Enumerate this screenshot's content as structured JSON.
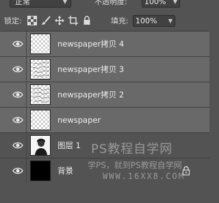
{
  "header": {
    "blend_mode": "正常",
    "opacity_label": "不透明度:",
    "opacity_value": "100%"
  },
  "lock_row": {
    "lock_label": "锁定:",
    "fill_label": "填充:",
    "fill_value": "100%",
    "lock_icons": [
      "lock-transparent-pixels-icon",
      "lock-image-pixels-icon",
      "lock-position-icon",
      "lock-artboard-icon",
      "lock-all-icon"
    ]
  },
  "layers": [
    {
      "name": "newspaper拷贝 4",
      "visible": true,
      "thumb": "transparent",
      "selected": true
    },
    {
      "name": "newspaper拷贝 3",
      "visible": true,
      "thumb": "texture",
      "selected": true
    },
    {
      "name": "newspaper拷贝 2",
      "visible": true,
      "thumb": "texture",
      "selected": true
    },
    {
      "name": "newspaper",
      "visible": true,
      "thumb": "transparent",
      "selected": true
    },
    {
      "name": "图层 1",
      "visible": true,
      "thumb": "photo",
      "selected": false
    },
    {
      "name": "背景",
      "visible": true,
      "thumb": "black",
      "selected": false,
      "locked": true
    }
  ],
  "watermark": {
    "line1": "PS教程自学网",
    "line2": "学PS，就到PS教程自学网",
    "line3": "WWW.16XX8.COM"
  },
  "colors": {
    "panel_bg": "#535353",
    "selected_row": "#696969",
    "text": "#eeeeee"
  }
}
